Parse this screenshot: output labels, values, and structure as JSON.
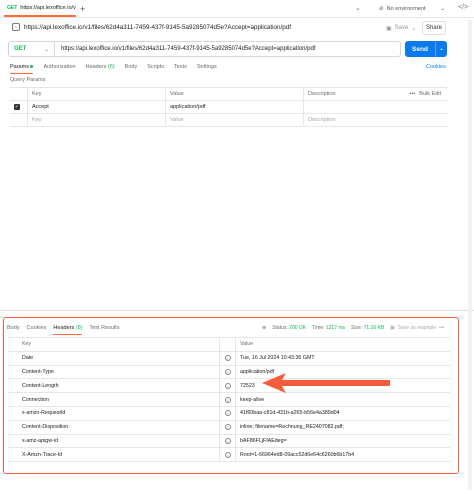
{
  "tab": {
    "method": "GET",
    "title": "https://api.lexoffice.io/v"
  },
  "env": {
    "label": "No environment"
  },
  "breadcrumb": {
    "url": "https://api.lexoffice.io/v1/files/62d4a311-7459-437f-9145-5a9285074d5e?Accept=application/pdf"
  },
  "toolbar": {
    "save_label": "Save",
    "share_label": "Share"
  },
  "request": {
    "method": "GET",
    "url": "https://api.lexoffice.io/v1/files/62d4a311-7459-437f-9145-5a9285074d5e?Accept=application/pdf",
    "send_label": "Send"
  },
  "request_tabs": {
    "params": "Params",
    "authorization": "Authorization",
    "headers": "Headers",
    "headers_count": "(6)",
    "body": "Body",
    "scripts": "Scripts",
    "tests": "Tests",
    "settings": "Settings",
    "cookies": "Cookies"
  },
  "query_params": {
    "title": "Query Params",
    "col_key": "Key",
    "col_value": "Value",
    "col_description": "Description",
    "bulk_edit": "Bulk Edit",
    "rows": [
      {
        "key": "Accept",
        "value": "application/pdf"
      }
    ],
    "placeholder_key": "Key",
    "placeholder_value": "Value",
    "placeholder_description": "Description"
  },
  "response_tabs": {
    "body": "Body",
    "cookies": "Cookies",
    "headers": "Headers",
    "headers_count": "(8)",
    "test_results": "Test Results"
  },
  "status": {
    "status_label": "Status:",
    "status_value": "200 OK",
    "time_label": "Time:",
    "time_value": "1217 ms",
    "size_label": "Size:",
    "size_value": "71.16 KB",
    "save_example": "Save as example"
  },
  "response_headers": {
    "col_key": "Key",
    "col_value": "Value",
    "rows": [
      {
        "key": "Date",
        "value": "Tue, 16 Jul 2024 10:43:36 GMT"
      },
      {
        "key": "Content-Type",
        "value": "application/pdf"
      },
      {
        "key": "Content-Length",
        "value": "72523"
      },
      {
        "key": "Connection",
        "value": "keep-alive"
      },
      {
        "key": "x-amzn-RequestId",
        "value": "41f60baa-c81d-431b-a265-b56e4a389d04"
      },
      {
        "key": "Content-Disposition",
        "value": "inline; filename=Rechnung_RE2407082.pdf;"
      },
      {
        "key": "x-amz-apigw-id",
        "value": "bAF86FLjFIAEdeg="
      },
      {
        "key": "X-Amzn-Trace-Id",
        "value": "Root=1-66964ed8-09acc52d6e64c6260b6b17b4"
      }
    ]
  },
  "colors": {
    "accent": "#ff6c37",
    "send": "#097bed",
    "get": "#0cbb52",
    "highlight": "#f45d3b"
  }
}
